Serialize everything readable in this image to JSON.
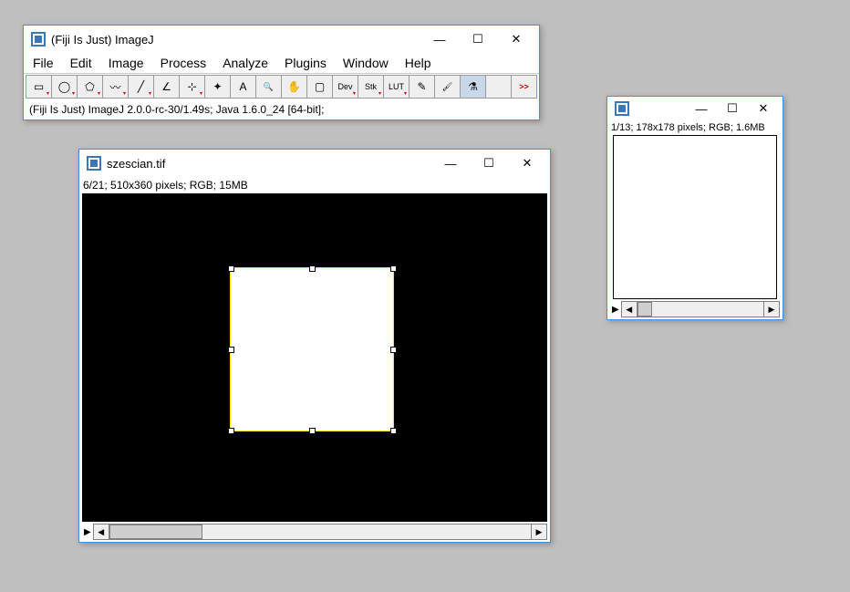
{
  "main": {
    "title": "(Fiji Is Just) ImageJ",
    "menus": [
      "File",
      "Edit",
      "Image",
      "Process",
      "Analyze",
      "Plugins",
      "Window",
      "Help"
    ],
    "tools": [
      {
        "name": "rectangle-tool",
        "label": "▭",
        "hasMore": true
      },
      {
        "name": "oval-tool",
        "label": "◯",
        "hasMore": true
      },
      {
        "name": "polygon-tool",
        "label": "⬠",
        "hasMore": true
      },
      {
        "name": "freehand-tool",
        "label": "〰",
        "hasMore": true
      },
      {
        "name": "line-tool",
        "label": "╱",
        "hasMore": true
      },
      {
        "name": "angle-tool",
        "label": "∠",
        "hasMore": false
      },
      {
        "name": "point-tool",
        "label": "⊹",
        "hasMore": true
      },
      {
        "name": "wand-tool",
        "label": "✦",
        "hasMore": false
      },
      {
        "name": "text-tool",
        "label": "A",
        "hasMore": false
      },
      {
        "name": "zoom-tool",
        "label": "🔍",
        "hasMore": false
      },
      {
        "name": "hand-tool",
        "label": "✋",
        "hasMore": false
      },
      {
        "name": "color-picker",
        "label": "▢",
        "hasMore": false
      },
      {
        "name": "dev-menu",
        "label": "Dev",
        "hasMore": true
      },
      {
        "name": "stk-menu",
        "label": "Stk",
        "hasMore": true
      },
      {
        "name": "lut-menu",
        "label": "LUT",
        "hasMore": true
      },
      {
        "name": "pencil-tool",
        "label": "✎",
        "hasMore": false
      },
      {
        "name": "brush-tool",
        "label": "🖌",
        "hasMore": false
      },
      {
        "name": "flood-tool",
        "label": "⚗",
        "hasMore": false,
        "active": true
      },
      {
        "name": "spacer",
        "label": "",
        "hasMore": false
      },
      {
        "name": "more-tools",
        "label": ">>",
        "hasMore": false
      }
    ],
    "status": "(Fiji Is Just) ImageJ 2.0.0-rc-30/1.49s; Java 1.6.0_24 [64-bit];"
  },
  "imgWin1": {
    "title": "szescian.tif",
    "info": "6/21; 510x360 pixels; RGB; 15MB"
  },
  "imgWin2": {
    "title": "",
    "info": "1/13; 178x178 pixels; RGB; 1.6MB"
  },
  "icon_glyph": "IJ"
}
